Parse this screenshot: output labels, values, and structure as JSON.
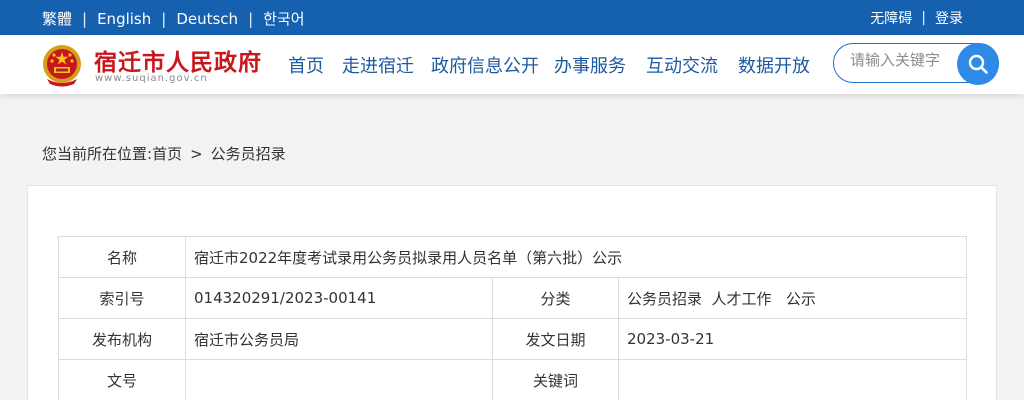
{
  "topbar": {
    "lang_traditional": "繁體",
    "lang_english": "English",
    "lang_deutsch": "Deutsch",
    "lang_other": "한국어",
    "separator": "|",
    "accessibility": "无障碍",
    "login": "登录"
  },
  "header": {
    "site_title": "宿迁市人民政府",
    "site_domain": "www.suqian.gov.cn",
    "nav": [
      "首页",
      "走进宿迁",
      "政府信息公开",
      "办事服务",
      "互动交流",
      "数据开放"
    ],
    "search_placeholder": "请输入关键字"
  },
  "breadcrumb": {
    "prefix": "您当前所在位置:",
    "home": "首页",
    "separator": ">",
    "current": "公务员招录"
  },
  "info_table": {
    "name_label": "名称",
    "name_value": "宿迁市2022年度考试录用公务员拟录用人员名单（第六批）公示",
    "index_label": "索引号",
    "index_value": "014320291/2023-00141",
    "category_label": "分类",
    "category_value": "公务员招录  人才工作   公示",
    "publisher_label": "发布机构",
    "publisher_value": "宿迁市公务员局",
    "date_label": "发文日期",
    "date_value": "2023-03-21",
    "docno_label": "文号",
    "docno_value": "",
    "keywords_label": "关键词",
    "keywords_value": ""
  },
  "colors": {
    "topbar_bg": "#1660b0",
    "title_red": "#c8161d",
    "nav_blue": "#1e5aa0",
    "search_button": "#2e8ae6"
  }
}
